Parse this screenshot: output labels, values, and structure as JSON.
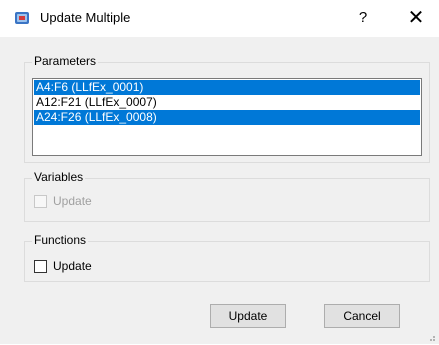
{
  "window": {
    "title": "Update Multiple",
    "help_glyph": "?",
    "close_glyph": "✕"
  },
  "parameters": {
    "label": "Parameters",
    "items": [
      {
        "text": "A4:F6 (LLfEx_0001)",
        "selected": true
      },
      {
        "text": "A12:F21 (LLfEx_0007)",
        "selected": false
      },
      {
        "text": "A24:F26 (LLfEx_0008)",
        "selected": true
      }
    ]
  },
  "variables": {
    "label": "Variables",
    "update_label": "Update",
    "update_checked": false,
    "enabled": false
  },
  "functions": {
    "label": "Functions",
    "update_label": "Update",
    "update_checked": false,
    "enabled": true
  },
  "buttons": {
    "update": "Update",
    "cancel": "Cancel"
  },
  "colors": {
    "selection": "#0078d7",
    "dialog_bg": "#f0f0f0"
  }
}
